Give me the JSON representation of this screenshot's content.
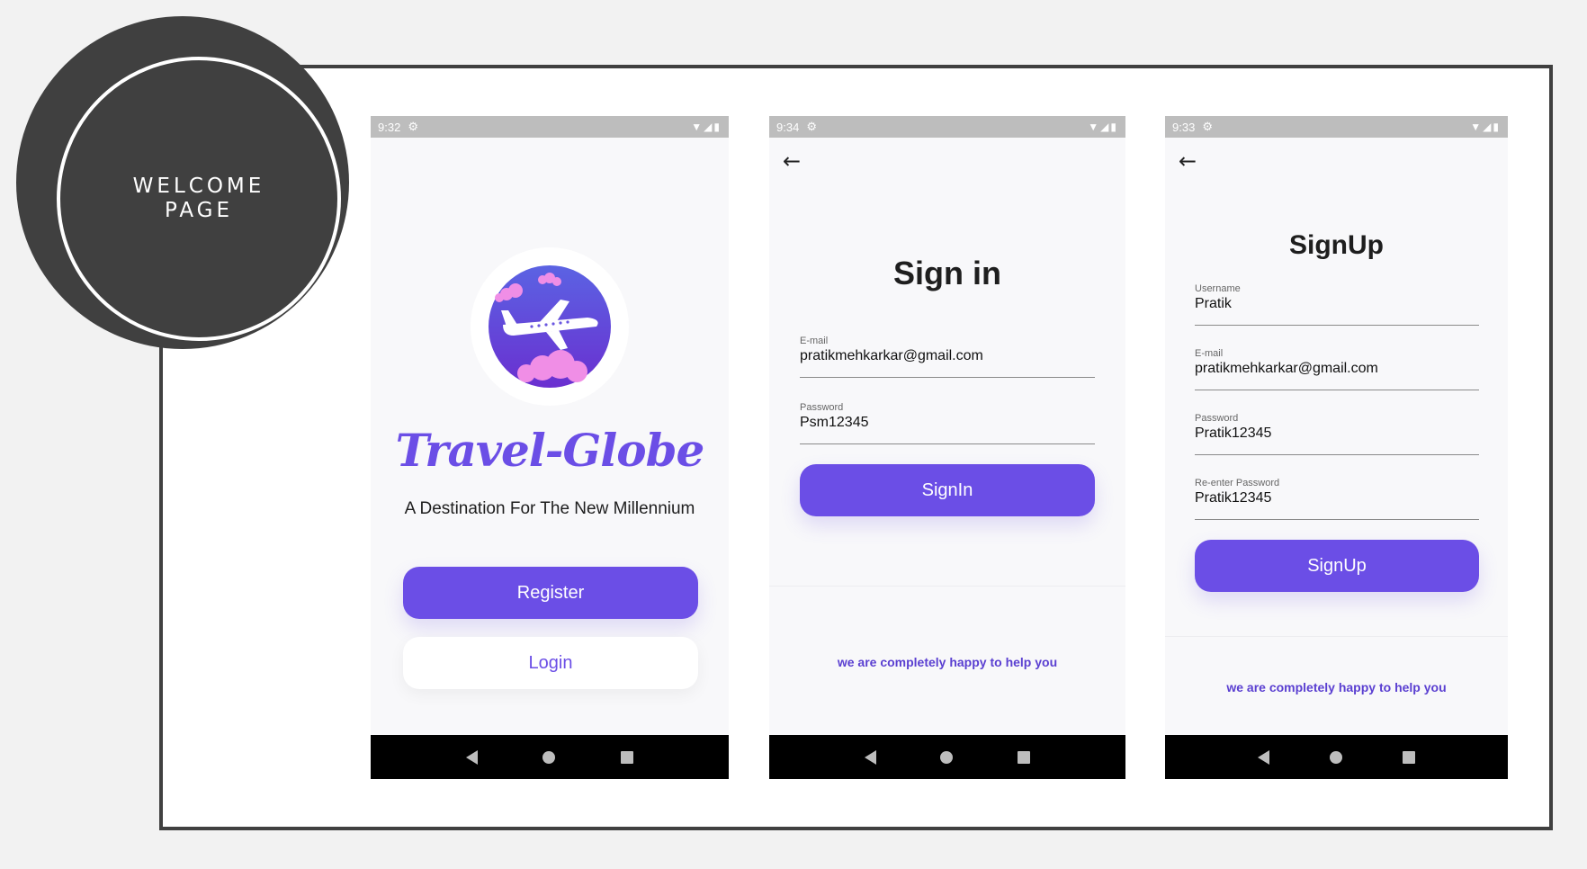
{
  "badge": {
    "line1": "WELCOME",
    "line2": "PAGE"
  },
  "colors": {
    "accent": "#6b4ee6",
    "frame": "#404040",
    "navbar": "#000000",
    "statusbar": "#bdbdbd"
  },
  "phones": {
    "welcome": {
      "status_time": "9:32",
      "brand": "Travel-Globe",
      "tagline": "A Destination For The New Millennium",
      "register_label": "Register",
      "login_label": "Login"
    },
    "signin": {
      "status_time": "9:34",
      "title": "Sign in",
      "email_label": "E-mail",
      "email_value": "pratikmehkarkar@gmail.com",
      "password_label": "Password",
      "password_value": "Psm12345",
      "button_label": "SignIn",
      "help_text": "we are completely happy to help you"
    },
    "signup": {
      "status_time": "9:33",
      "title": "SignUp",
      "username_label": "Username",
      "username_value": "Pratik",
      "email_label": "E-mail",
      "email_value": "pratikmehkarkar@gmail.com",
      "password_label": "Password",
      "password_value": "Pratik12345",
      "reenter_label": "Re-enter Password",
      "reenter_value": "Pratik12345",
      "button_label": "SignUp",
      "help_text": "we are completely happy to help you"
    }
  },
  "icons": {
    "settings": "gear-icon",
    "wifi": "wifi-icon",
    "signal": "signal-icon",
    "battery": "battery-icon",
    "back": "back-arrow-icon",
    "nav_back": "nav-back-icon",
    "nav_home": "nav-home-icon",
    "nav_recent": "nav-recent-icon",
    "logo": "airplane-logo-icon"
  }
}
